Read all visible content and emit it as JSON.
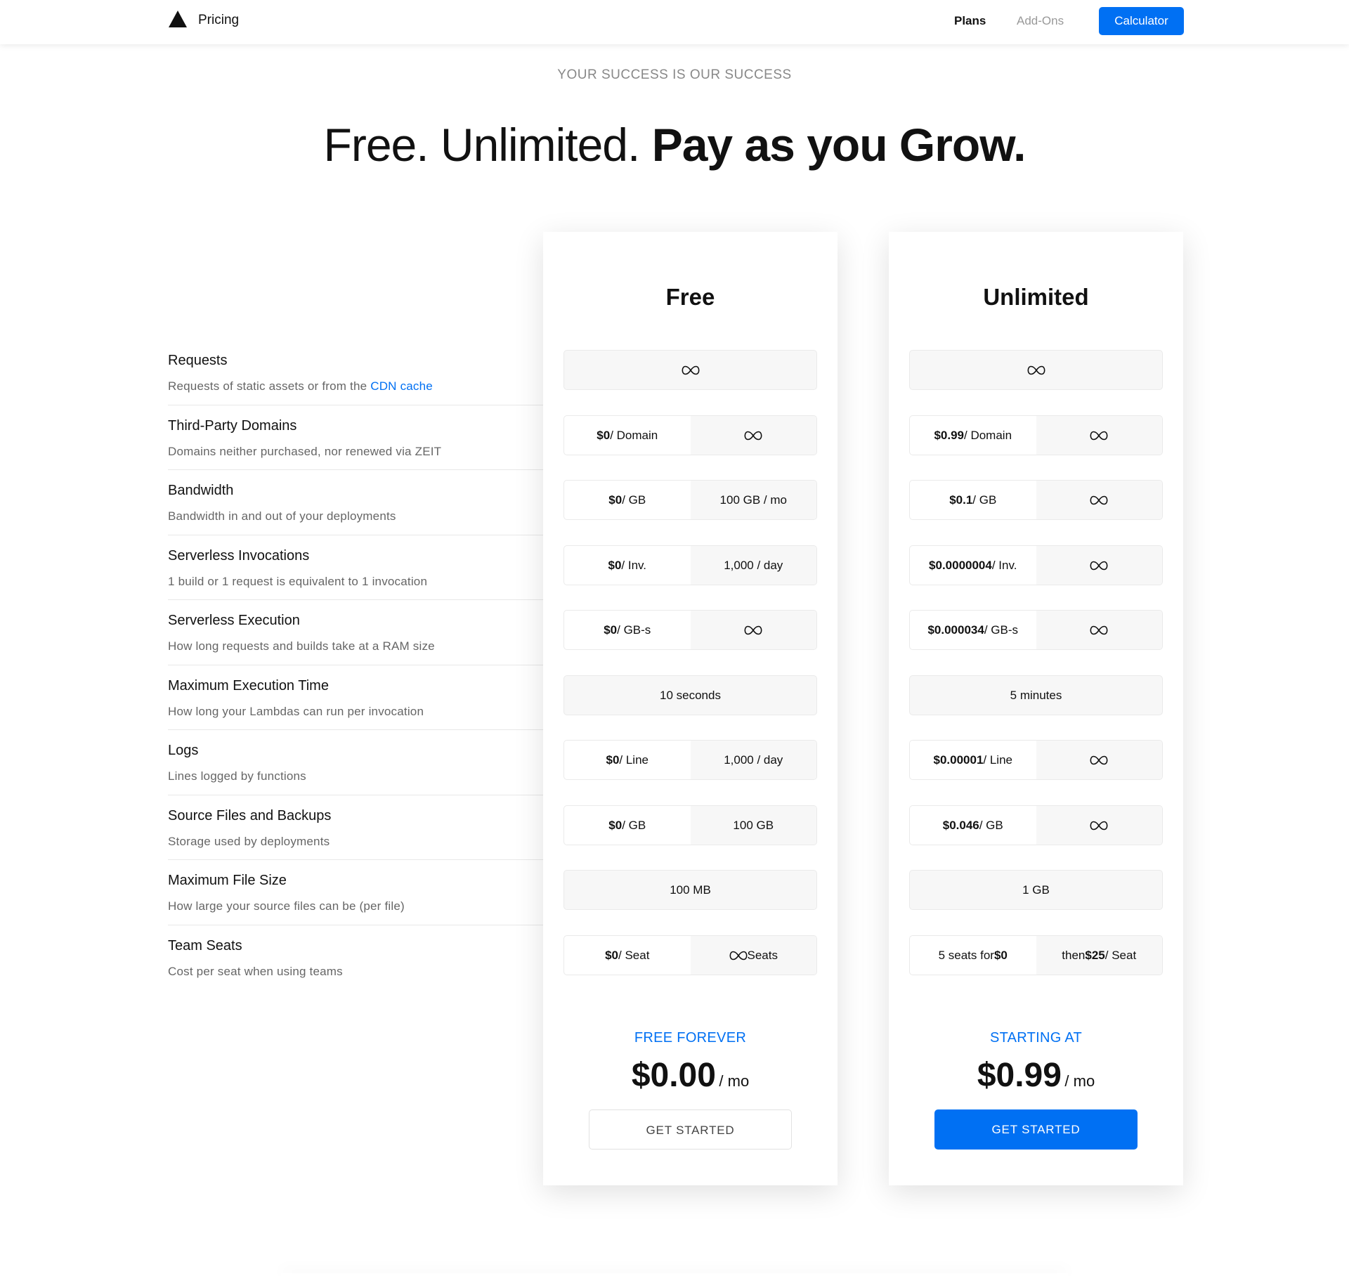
{
  "header": {
    "brand": "Pricing",
    "nav": {
      "plans": "Plans",
      "addons": "Add-Ons",
      "calculator": "Calculator"
    }
  },
  "hero": {
    "eyebrow": "YOUR SUCCESS IS OUR SUCCESS",
    "headline_regular": "Free. Unlimited. ",
    "headline_bold": "Pay as you Grow."
  },
  "features": [
    {
      "title": "Requests",
      "desc": "Requests of static assets or from the ",
      "link": "CDN cache"
    },
    {
      "title": "Third-Party Domains",
      "desc": "Domains neither purchased, nor renewed via ZEIT"
    },
    {
      "title": "Bandwidth",
      "desc": "Bandwidth in and out of your deployments"
    },
    {
      "title": "Serverless Invocations",
      "desc": "1 build or 1 request is equivalent to 1 invocation"
    },
    {
      "title": "Serverless Execution",
      "desc": "How long requests and builds take at a RAM size"
    },
    {
      "title": "Maximum Execution Time",
      "desc": "How long your Lambdas can run per invocation"
    },
    {
      "title": "Logs",
      "desc": "Lines logged by functions"
    },
    {
      "title": "Source Files and Backups",
      "desc": "Storage used by deployments"
    },
    {
      "title": "Maximum File Size",
      "desc": "How large your source files can be (per file)"
    },
    {
      "title": "Team Seats",
      "desc": "Cost per seat when using teams"
    }
  ],
  "plans": {
    "free": {
      "title": "Free",
      "domain": {
        "price": "$0",
        "unit": " / Domain"
      },
      "bandwidth": {
        "price": "$0",
        "unit": " / GB",
        "limit": "100 GB / mo"
      },
      "invocations": {
        "price": "$0",
        "unit": " / Inv.",
        "limit": "1,000 / day"
      },
      "execution": {
        "price": "$0",
        "unit": " / GB-s"
      },
      "max_exec_time": "10 seconds",
      "logs": {
        "price": "$0",
        "unit": " / Line",
        "limit": "1,000 / day"
      },
      "source": {
        "price": "$0",
        "unit": " / GB",
        "limit": "100 GB"
      },
      "max_file": "100 MB",
      "seats": {
        "price": "$0",
        "unit": " / Seat",
        "limit_suffix": " Seats"
      },
      "price_eyebrow": "FREE FOREVER",
      "price": "$0.00",
      "per": "/ mo",
      "cta": "GET STARTED"
    },
    "unlimited": {
      "title": "Unlimited",
      "domain": {
        "price": "$0.99",
        "unit": " / Domain"
      },
      "bandwidth": {
        "price": "$0.1",
        "unit": " / GB"
      },
      "invocations": {
        "price": "$0.0000004",
        "unit": " / Inv."
      },
      "execution": {
        "price": "$0.000034",
        "unit": " / GB-s"
      },
      "max_exec_time": "5 minutes",
      "logs": {
        "price": "$0.00001",
        "unit": " / Line"
      },
      "source": {
        "price": "$0.046",
        "unit": " / GB"
      },
      "max_file": "1 GB",
      "seats": {
        "included_prefix": "5 seats for ",
        "included_price": "$0",
        "then_prefix": "then ",
        "then_price": "$25",
        "then_unit": " / Seat"
      },
      "price_eyebrow": "STARTING AT",
      "price": "$0.99",
      "per": "/ mo",
      "cta": "GET STARTED"
    }
  },
  "colors": {
    "accent": "#0070f3",
    "cell_bg": "#f7f7f7"
  },
  "icons": {
    "unlimited": "infinity-icon",
    "logo": "triangle-logo-icon"
  }
}
